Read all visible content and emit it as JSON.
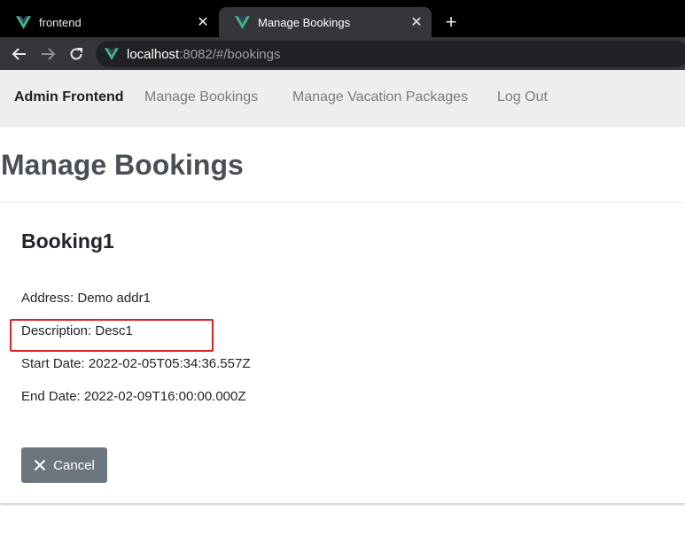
{
  "browser": {
    "tabs": [
      {
        "title": "frontend",
        "icon": "vue-logo-icon",
        "active": false
      },
      {
        "title": "Manage Bookings",
        "icon": "vue-logo-icon",
        "active": true
      }
    ],
    "new_tab_symbol": "+",
    "url": {
      "host": "localhost",
      "rest": ":8082/#/bookings"
    }
  },
  "navbar": {
    "brand": "Admin Frontend",
    "links": [
      "Manage Bookings",
      "Manage Vacation Packages",
      "Log Out"
    ]
  },
  "page": {
    "heading": "Manage Bookings",
    "booking": {
      "title": "Booking1",
      "address": "Address: Demo addr1",
      "description": "Description: Desc1",
      "start_date": "Start Date: 2022-02-05T05:34:36.557Z",
      "end_date": "End Date: 2022-02-09T16:00:00.000Z",
      "cancel_label": "Cancel"
    }
  },
  "colors": {
    "vue_green": "#41b883",
    "highlight_red": "#e02020",
    "cancel_button_bg": "#6c757d",
    "navbar_bg": "#eeeeee"
  }
}
